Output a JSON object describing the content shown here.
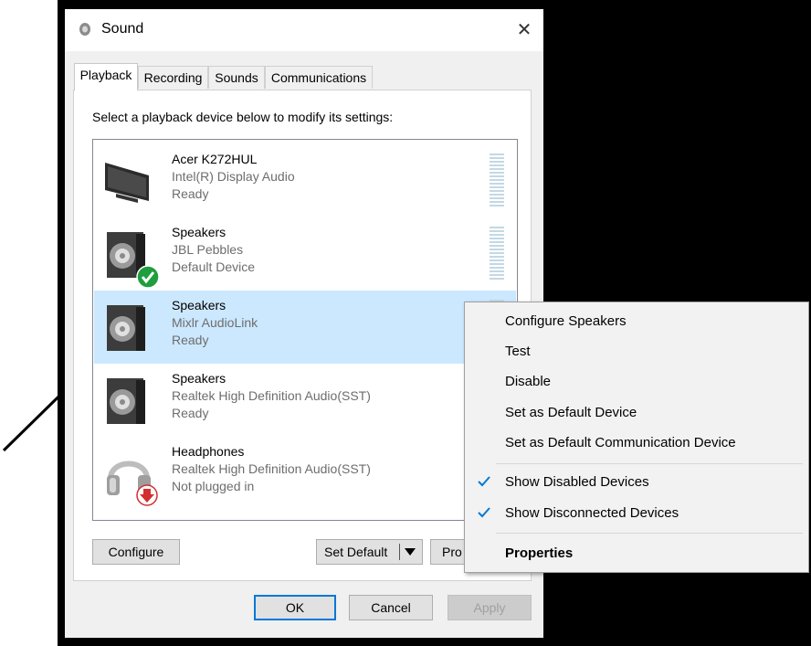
{
  "window": {
    "title": "Sound",
    "close_glyph": "✕"
  },
  "tabs": [
    {
      "label": "Playback",
      "active": true
    },
    {
      "label": "Recording"
    },
    {
      "label": "Sounds"
    },
    {
      "label": "Communications"
    }
  ],
  "instruction": "Select a playback device below to modify its settings:",
  "devices": [
    {
      "name": "Acer K272HUL",
      "desc": "Intel(R) Display Audio",
      "status": "Ready",
      "icon": "monitor-icon"
    },
    {
      "name": "Speakers",
      "desc": "JBL Pebbles",
      "status": "Default Device",
      "icon": "speaker-icon",
      "badge": "default-check-icon"
    },
    {
      "name": "Speakers",
      "desc": "Mixlr AudioLink",
      "status": "Ready",
      "icon": "speaker-icon",
      "selected": true
    },
    {
      "name": "Speakers",
      "desc": "Realtek High Definition Audio(SST)",
      "status": "Ready",
      "icon": "speaker-icon"
    },
    {
      "name": "Headphones",
      "desc": "Realtek High Definition Audio(SST)",
      "status": "Not plugged in",
      "icon": "headphones-icon",
      "badge": "unplugged-arrow-icon"
    }
  ],
  "buttons": {
    "configure": "Configure",
    "set_default": "Set Default",
    "properties_partial": "Pro",
    "ok": "OK",
    "cancel": "Cancel",
    "apply": "Apply"
  },
  "context_menu": {
    "items": [
      {
        "label": "Configure Speakers"
      },
      {
        "label": "Test"
      },
      {
        "label": "Disable"
      },
      {
        "label": "Set as Default Device"
      },
      {
        "label": "Set as Default Communication Device"
      },
      {
        "label": "Show Disabled Devices",
        "checked": true
      },
      {
        "label": "Show Disconnected Devices",
        "checked": true
      },
      {
        "label": "Properties",
        "bold": true
      }
    ]
  },
  "colors": {
    "selection": "#cce8ff",
    "accent": "#0078d7",
    "check": "#0078d7",
    "default_badge": "#1e9e3e",
    "unplugged_badge": "#d32f2f"
  }
}
